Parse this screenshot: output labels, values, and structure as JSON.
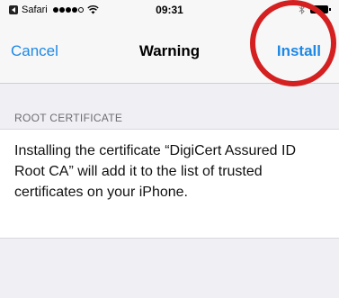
{
  "status_bar": {
    "app": "Safari",
    "time": "09:31"
  },
  "nav": {
    "cancel_label": "Cancel",
    "title": "Warning",
    "install_label": "Install"
  },
  "section": {
    "header": "ROOT CERTIFICATE",
    "body": "Installing the certificate “DigiCert Assured ID Root CA” will add it to the list of trusted certificates on your iPhone."
  },
  "colors": {
    "accent": "#1e88e5",
    "highlight_ring": "#d42020",
    "background": "#efeff4"
  },
  "icons": [
    "back-to-app-icon",
    "signal-strength-icon",
    "wifi-icon",
    "bluetooth-icon",
    "battery-icon"
  ]
}
